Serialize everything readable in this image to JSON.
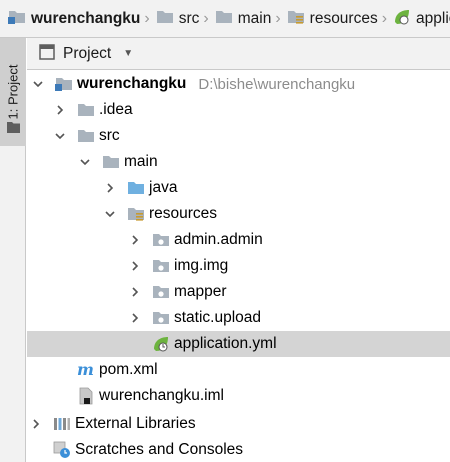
{
  "breadcrumb": {
    "items": [
      {
        "label": "wurenchangku",
        "icon": "module-folder-icon"
      },
      {
        "label": "src",
        "icon": "folder-icon"
      },
      {
        "label": "main",
        "icon": "folder-icon"
      },
      {
        "label": "resources",
        "icon": "resources-folder-icon"
      },
      {
        "label": "applic",
        "icon": "spring-yml-icon"
      }
    ]
  },
  "side_strip": {
    "tab_label": "1: Project"
  },
  "project_panel": {
    "title": "Project"
  },
  "tree": {
    "root": {
      "label": "wurenchangku",
      "path": "D:\\bishe\\wurenchangku"
    },
    "idea": ".idea",
    "src": "src",
    "main": "main",
    "java": "java",
    "resources": "resources",
    "packages": [
      "admin.admin",
      "img.img",
      "mapper",
      "static.upload"
    ],
    "application_yml": "application.yml",
    "pom": "pom.xml",
    "iml": "wurenchangku.iml",
    "external_libraries": "External Libraries",
    "scratches": "Scratches and Consoles"
  },
  "colors": {
    "folder": "#a9b3bd",
    "java_folder": "#6fb0e0",
    "selected_row": "#d4d4d4",
    "spring_green": "#6db33f",
    "maven_blue": "#3b8fd8"
  }
}
